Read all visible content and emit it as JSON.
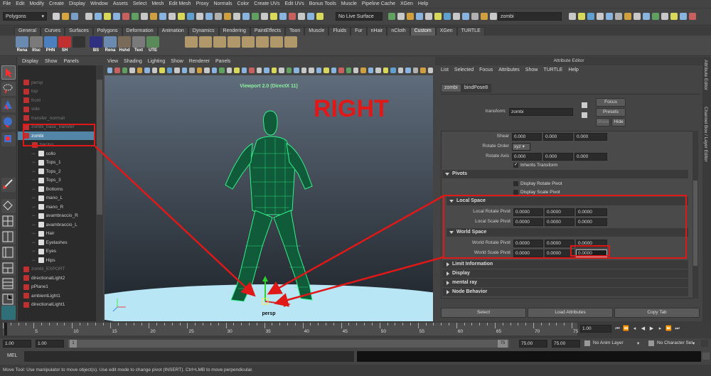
{
  "menubar": [
    "File",
    "Edit",
    "Modify",
    "Create",
    "Display",
    "Window",
    "Assets",
    "Select",
    "Mesh",
    "Edit Mesh",
    "Proxy",
    "Normals",
    "Color",
    "Create UVs",
    "Edit UVs",
    "Bonus Tools",
    "Muscle",
    "Pipeline Cache",
    "XGen",
    "Help"
  ],
  "status": {
    "mode": "Polygons",
    "live_surface": "No Live Surface",
    "object_name": "zombi"
  },
  "shelf_tabs": [
    "General",
    "Curves",
    "Surfaces",
    "Polygons",
    "Deformation",
    "Animation",
    "Dynamics",
    "Rendering",
    "PaintEffects",
    "Toon",
    "Muscle",
    "Fluids",
    "Fur",
    "nHair",
    "nCloth",
    "Custom",
    "XGen",
    "TURTLE"
  ],
  "shelf_active": "Custom",
  "shelf_buttons": [
    "Rena",
    "lltsc",
    "PHN",
    "SH",
    "",
    "BS",
    "Rena",
    "Hshd",
    "Text",
    "UTE"
  ],
  "outliner": {
    "menu": [
      "Display",
      "Show",
      "Panels"
    ],
    "items": [
      {
        "label": "persp",
        "indent": 0,
        "dim": true,
        "sel": false
      },
      {
        "label": "top",
        "indent": 0,
        "dim": true,
        "sel": false
      },
      {
        "label": "front",
        "indent": 0,
        "dim": true,
        "sel": false
      },
      {
        "label": "side",
        "indent": 0,
        "dim": true,
        "sel": false
      },
      {
        "label": "transfer_normali",
        "indent": 0,
        "dim": true,
        "sel": false
      },
      {
        "label": "zombi_base_transfer",
        "indent": 0,
        "dim": true,
        "sel": false
      },
      {
        "label": "zombi",
        "indent": 0,
        "dim": false,
        "sel": true
      },
      {
        "label": "bacino",
        "indent": 1,
        "dim": true,
        "sel": false
      },
      {
        "label": "collo",
        "indent": 2,
        "dim": false,
        "sel": false
      },
      {
        "label": "Tops_1",
        "indent": 2,
        "dim": false,
        "sel": false
      },
      {
        "label": "Tops_2",
        "indent": 2,
        "dim": false,
        "sel": false
      },
      {
        "label": "Tops_3",
        "indent": 2,
        "dim": false,
        "sel": false
      },
      {
        "label": "Bottoms",
        "indent": 2,
        "dim": false,
        "sel": false
      },
      {
        "label": "mano_L",
        "indent": 2,
        "dim": false,
        "sel": false
      },
      {
        "label": "mano_R",
        "indent": 2,
        "dim": false,
        "sel": false
      },
      {
        "label": "avambraccio_R",
        "indent": 2,
        "dim": false,
        "sel": false
      },
      {
        "label": "avambraccio_L",
        "indent": 2,
        "dim": false,
        "sel": false
      },
      {
        "label": "Hair",
        "indent": 2,
        "dim": false,
        "sel": false
      },
      {
        "label": "Eyelashes",
        "indent": 2,
        "dim": false,
        "sel": false
      },
      {
        "label": "Eyes",
        "indent": 2,
        "dim": false,
        "sel": false
      },
      {
        "label": "Hips",
        "indent": 2,
        "dim": false,
        "sel": false
      },
      {
        "label": "zombi_EXPORT",
        "indent": 0,
        "dim": true,
        "sel": false
      },
      {
        "label": "directionalLight2",
        "indent": 0,
        "dim": false,
        "sel": false
      },
      {
        "label": "pPlane1",
        "indent": 0,
        "dim": false,
        "sel": false
      },
      {
        "label": "ambientLight1",
        "indent": 0,
        "dim": false,
        "sel": false
      },
      {
        "label": "directionalLight1",
        "indent": 0,
        "dim": false,
        "sel": false
      }
    ]
  },
  "viewport": {
    "menu": [
      "View",
      "Shading",
      "Lighting",
      "Show",
      "Renderer",
      "Panels"
    ],
    "title": "Viewport 2.0 (DirectX 11)",
    "camera": "persp",
    "overlay_text": "RIGHT",
    "accent": "#34f28a"
  },
  "attribute_editor": {
    "title": "Attribute Editor",
    "menu": [
      "List",
      "Selected",
      "Focus",
      "Attributes",
      "Show",
      "TURTLE",
      "Help"
    ],
    "tabs": [
      "zombi",
      "bindPose8"
    ],
    "transform_label": "transform:",
    "transform_value": "zombi",
    "buttons": {
      "focus": "Focus",
      "presets": "Presets",
      "show": "Show",
      "hide": "Hide"
    },
    "shear": {
      "label": "Shear",
      "values": [
        "0.000",
        "0.000",
        "0.000"
      ]
    },
    "rotate_order": {
      "label": "Rotate Order",
      "value": "xyz"
    },
    "rotate_axis": {
      "label": "Rotate Axis",
      "values": [
        "0.000",
        "0.000",
        "0.000"
      ]
    },
    "inherits": "Inherits Transform",
    "pivots_header": "Pivots",
    "display_rotate_pivot": "Display Rotate Pivot",
    "display_scale_pivot": "Display Scale Pivot",
    "local_space": "Local Space",
    "local_rotate_pivot": {
      "label": "Local Rotate Pivot",
      "values": [
        "0.0000",
        "0.0000",
        "0.0000"
      ]
    },
    "local_scale_pivot": {
      "label": "Local Scale Pivot",
      "values": [
        "0.0000",
        "0.0000",
        "0.0000"
      ]
    },
    "world_space": "World Space",
    "world_rotate_pivot": {
      "label": "World Rotate Pivot",
      "values": [
        "0.0000",
        "0.0000",
        "0.0000"
      ]
    },
    "world_scale_pivot": {
      "label": "World Scale Pivot",
      "values": [
        "0.0000",
        "0.0000",
        "0.0000"
      ]
    },
    "collapsed_sections": [
      "Limit Information",
      "Display",
      "mental ray",
      "Node Behavior"
    ],
    "bottom_buttons": [
      "Select",
      "Load Attributes",
      "Copy Tab"
    ]
  },
  "sidebar_tabs": [
    "Attribute Editor",
    "Channel Box / Layer Editor"
  ],
  "timeline": {
    "ticks": [
      "1",
      "5",
      "10",
      "15",
      "20",
      "25",
      "30",
      "35",
      "40",
      "45",
      "50",
      "55",
      "60",
      "65",
      "70",
      "75"
    ],
    "current": "1.00"
  },
  "range": {
    "start": "1.00",
    "inner_start": "1.00",
    "inner_start_marker": "1",
    "inner_end_marker": "75",
    "end_a": "75.00",
    "end_b": "75.00",
    "anim_layer": "No Anim Layer",
    "character_set": "No Character Set"
  },
  "command": {
    "label": "MEL"
  },
  "help_line": "Move Tool: Use manipulator to move object(s). Use edit mode to change pivot (INSERT). Ctrl+LMB to move perpendicular.",
  "annotation_color": "#e01818"
}
